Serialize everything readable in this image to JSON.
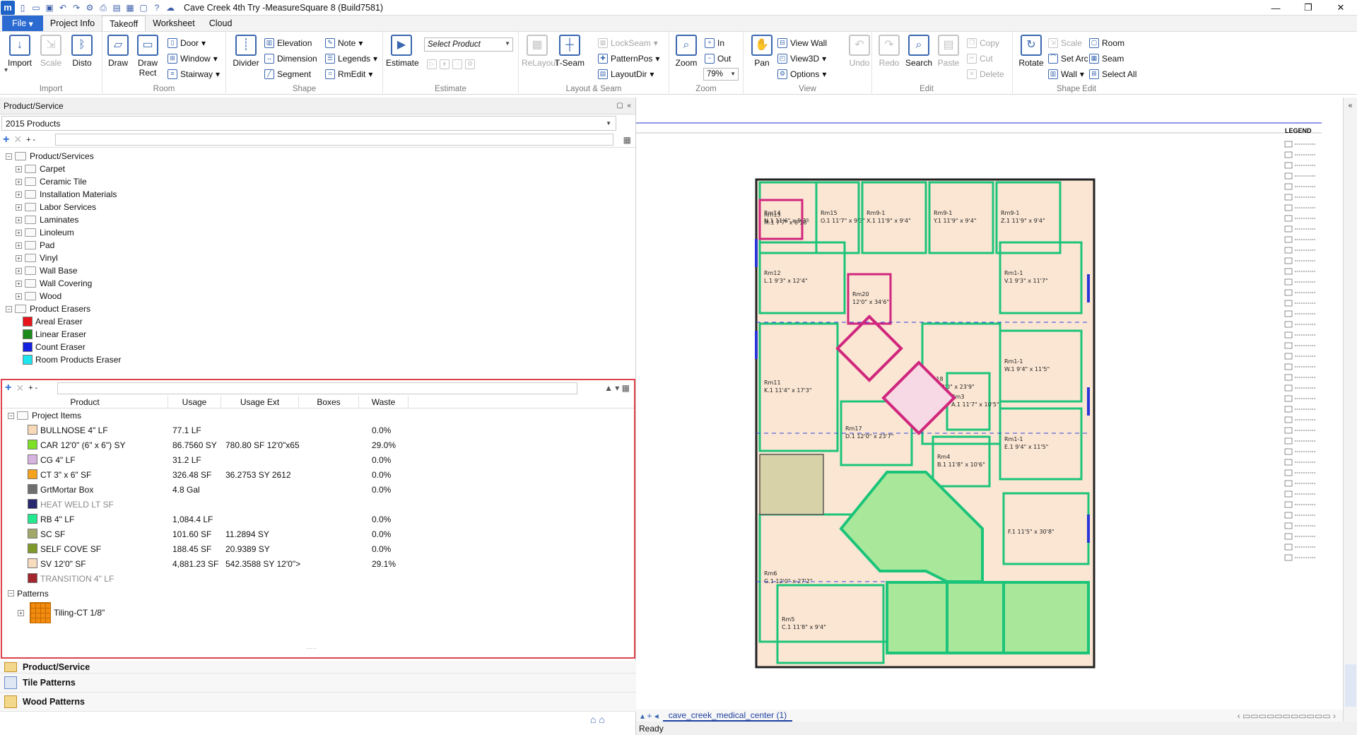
{
  "app": {
    "title": "Cave Creek 4th Try -MeasureSquare 8 (Build7581)",
    "logo": "m"
  },
  "tabs": [
    "File",
    "Project Info",
    "Takeoff",
    "Worksheet",
    "Cloud"
  ],
  "ribbon": {
    "import": {
      "import": "Import",
      "scale": "Scale",
      "disto": "Disto",
      "label": "Import"
    },
    "room": {
      "draw": "Draw",
      "draw_rect": "Draw Rect",
      "door": "Door",
      "window": "Window",
      "stairway": "Stairway",
      "label": "Room"
    },
    "shape": {
      "divider": "Divider",
      "elevation": "Elevation",
      "dimension": "Dimension",
      "segment": "Segment",
      "note": "Note",
      "legends": "Legends",
      "rmedit": "RmEdit",
      "label": "Shape"
    },
    "estimate": {
      "estimate": "Estimate",
      "select_product": "Select Product",
      "label": "Estimate"
    },
    "layout": {
      "relayout": "ReLayout",
      "tseam": "T-Seam",
      "lockseam": "LockSeam",
      "patternpos": "PatternPos",
      "layoutdir": "LayoutDir",
      "label": "Layout & Seam"
    },
    "zoom": {
      "zoom": "Zoom",
      "in": "In",
      "out": "Out",
      "value": "79%",
      "label": "Zoom"
    },
    "view": {
      "pan": "Pan",
      "view_wall": "View Wall",
      "view3d": "View3D",
      "options": "Options",
      "label": "View"
    },
    "edit": {
      "undo": "Undo",
      "redo": "Redo",
      "search": "Search",
      "paste": "Paste",
      "copy": "Copy",
      "cut": "Cut",
      "delete": "Delete",
      "label": "Edit"
    },
    "shape_edit": {
      "rotate": "Rotate",
      "scale": "Scale",
      "set_arc": "Set Arc",
      "wall": "Wall",
      "room": "Room",
      "seam": "Seam",
      "select_all": "Select All",
      "label": "Shape Edit"
    }
  },
  "panel": {
    "title": "Product/Service",
    "catalog": "2015 Products",
    "tree_root": "Product/Services",
    "categories": [
      "Carpet",
      "Ceramic Tile",
      "Installation Materials",
      "Labor Services",
      "Laminates",
      "Linoleum",
      "Pad",
      "Vinyl",
      "Wall Base",
      "Wall Covering",
      "Wood"
    ],
    "erasers_root": "Product Erasers",
    "erasers": [
      {
        "label": "Areal Eraser",
        "color": "#e8141c"
      },
      {
        "label": "Linear Eraser",
        "color": "#1a8a1a"
      },
      {
        "label": "Count Eraser",
        "color": "#1420e0"
      },
      {
        "label": "Room Products Eraser",
        "color": "#1ee6ee"
      }
    ]
  },
  "items_table": {
    "headers": [
      "Product",
      "Usage",
      "Usage Ext",
      "Boxes",
      "Waste"
    ],
    "project_root": "Project Items",
    "rows": [
      {
        "name": "BULLNOSE 4\" LF",
        "usage": "77.1 LF",
        "ext": "",
        "waste": "0.0%",
        "color": "#f7d9b8",
        "muted": false
      },
      {
        "name": "CAR 12'0\" (6\" x 6\") SY",
        "usage": "86.7560 SY",
        "ext": "780.80 SF 12'0\"x65",
        "waste": "29.0%",
        "color": "#7ee025",
        "muted": false
      },
      {
        "name": "CG 4\" LF",
        "usage": "31.2 LF",
        "ext": "",
        "waste": "0.0%",
        "color": "#d7b3e0",
        "muted": false
      },
      {
        "name": "CT 3\" x 6\" SF",
        "usage": "326.48 SF",
        "ext": "36.2753 SY 2612",
        "waste": "0.0%",
        "color": "#f5a21c",
        "muted": false
      },
      {
        "name": "GrtMortar Box",
        "usage": "4.8 Gal",
        "ext": "",
        "waste": "0.0%",
        "color": "#6f6f6f",
        "muted": false
      },
      {
        "name": "HEAT WELD LT  SF",
        "usage": "",
        "ext": "",
        "waste": "",
        "color": "#27286e",
        "muted": true
      },
      {
        "name": "RB 4\" LF",
        "usage": "1,084.4 LF",
        "ext": "",
        "waste": "0.0%",
        "color": "#22e890",
        "muted": false
      },
      {
        "name": "SC  SF",
        "usage": "101.60 SF",
        "ext": "11.2894 SY",
        "waste": "0.0%",
        "color": "#a3a86a",
        "muted": false
      },
      {
        "name": "SELF COVE  SF",
        "usage": "188.45 SF",
        "ext": "20.9389 SY",
        "waste": "0.0%",
        "color": "#7f9a2a",
        "muted": false
      },
      {
        "name": "SV 12'0\" SF",
        "usage": "4,881.23 SF",
        "ext": "542.3588 SY 12'0\">",
        "waste": "29.1%",
        "color": "#f7dcc0",
        "muted": false
      },
      {
        "name": "TRANSITION 4\" LF",
        "usage": "",
        "ext": "",
        "waste": "",
        "color": "#a1262e",
        "muted": true
      }
    ],
    "patterns_root": "Patterns",
    "pattern": "Tiling-CT 1/8\""
  },
  "bottom_tabs": [
    "Product/Service",
    "Tile Patterns",
    "Wood Patterns"
  ],
  "drawing": {
    "sheet_tab": "cave_creek_medical_center (1)",
    "legend": "LEGEND",
    "rooms": [
      {
        "n": "Rm14",
        "d": "N.1",
        "s": "11'6\" x 9'3\""
      },
      {
        "n": "Rm15",
        "d": "O.1",
        "s": "11'7\" x 9'3\""
      },
      {
        "n": "Rm9-1",
        "d": "X.1",
        "s": "11'9\" x 9'4\""
      },
      {
        "n": "Rm9-1",
        "d": "Y.1",
        "s": "11'9\" x 9'4\""
      },
      {
        "n": "Rm9-1",
        "d": "Z.1",
        "s": "11'9\" x 9'4\""
      },
      {
        "n": "Rm13",
        "d": "M.1",
        "s": "7'7\" x 8'10\""
      },
      {
        "n": "Rm12",
        "d": "L.1",
        "s": "9'3\" x 12'4\""
      },
      {
        "n": "Rm11",
        "d": "K.1",
        "s": "11'4\" x 17'3\""
      },
      {
        "n": "Rm18",
        "d": "B.1",
        "s": "12'0\" x 23'9\""
      },
      {
        "n": "Rm1-1",
        "d": "V.1",
        "s": "9'3\" x 11'7\""
      },
      {
        "n": "Rm1-1",
        "d": "W.1",
        "s": "9'4\" x 11'5\""
      },
      {
        "n": "Rm1-1",
        "d": "E.1",
        "s": "9'4\" x 11'5\""
      },
      {
        "n": "Rm17",
        "d": "D.1",
        "s": "12'0\" x 23'7\""
      },
      {
        "n": "Rm6",
        "d": "G.1",
        "s": "12'0\" x 27'2\""
      },
      {
        "n": "Rm5",
        "d": "C.1",
        "s": "11'8\" x 9'4\""
      },
      {
        "n": "Rm4",
        "d": "B.1",
        "s": "11'8\" x 10'6\""
      },
      {
        "n": "Rm3",
        "d": "A.1",
        "s": "11'7\" x 10'5\""
      },
      {
        "n": "",
        "d": "F.1",
        "s": "11'5\" x 30'8\""
      },
      {
        "n": "Rm20",
        "d": "",
        "s": "12'0\" x 34'6\""
      }
    ]
  },
  "status": "Ready"
}
